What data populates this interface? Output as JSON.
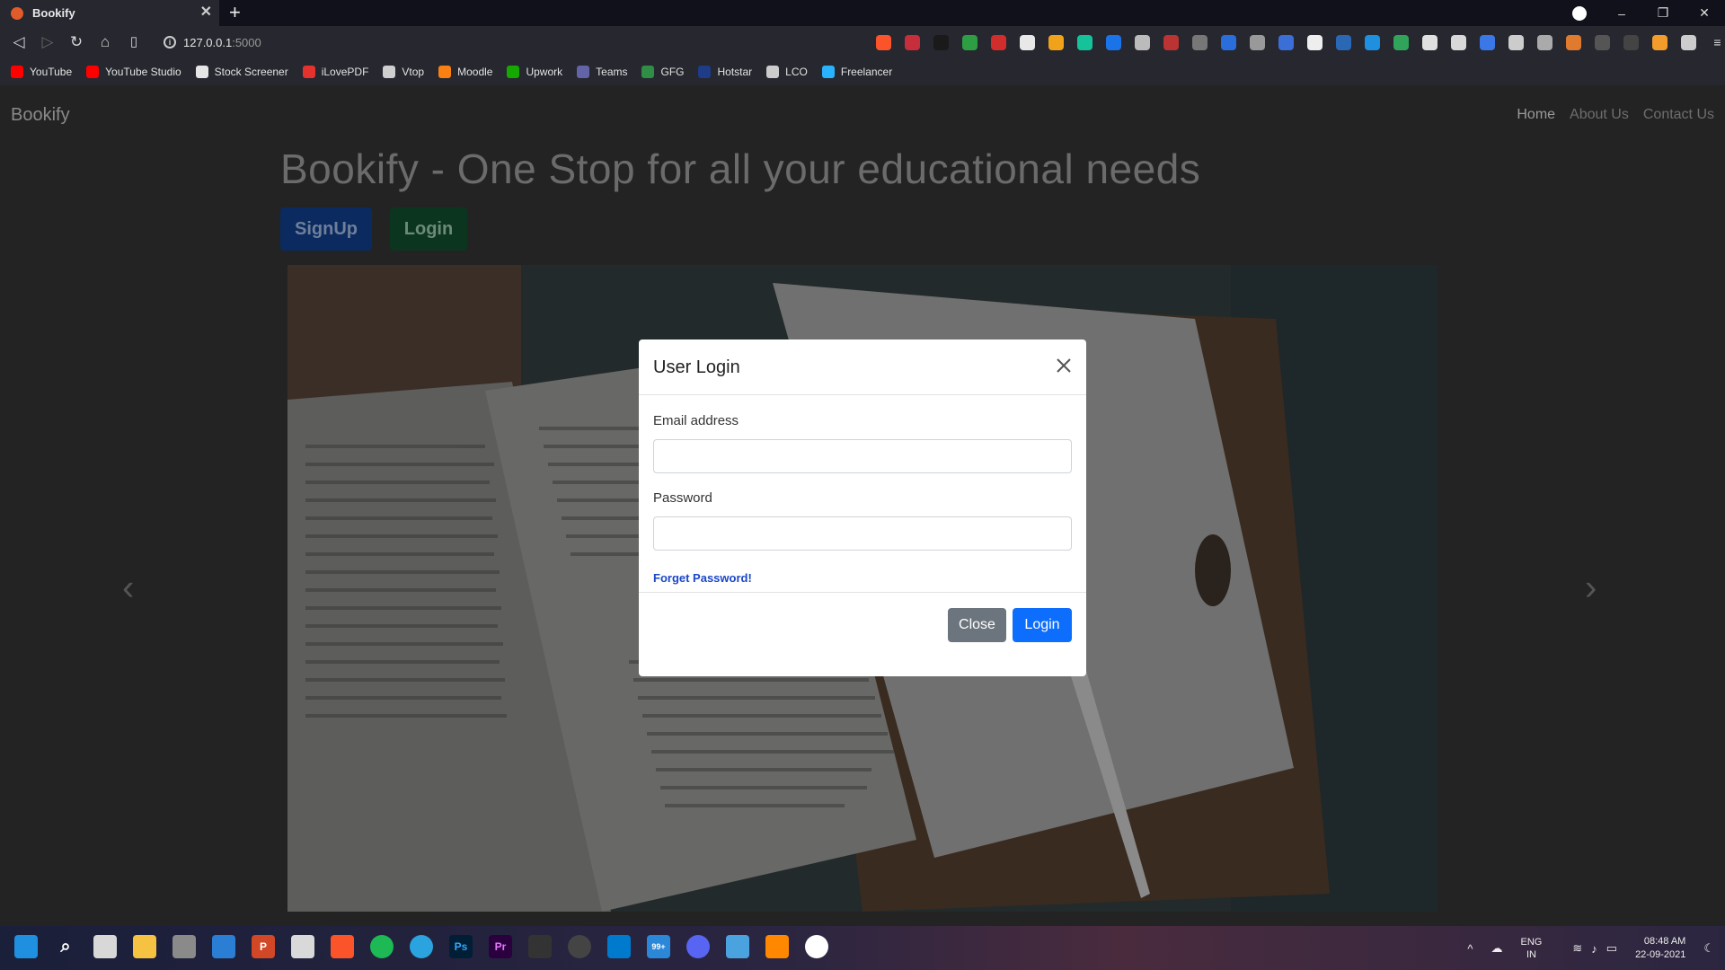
{
  "browser": {
    "tab_title": "Bookify",
    "new_tab": "+",
    "address": "127.0.0.1",
    "address_port": ":5000",
    "window_controls": [
      "–",
      "❐",
      "✕"
    ]
  },
  "bookmarks": [
    {
      "label": "YouTube",
      "icon": "youtube-icon",
      "color": "#ff0000"
    },
    {
      "label": "YouTube Studio",
      "icon": "youtube-studio-icon",
      "color": "#ff0000"
    },
    {
      "label": "Stock Screener",
      "icon": "screener-icon",
      "color": "#e6e6e6"
    },
    {
      "label": "iLovePDF",
      "icon": "ilovepdf-icon",
      "color": "#e5322d"
    },
    {
      "label": "Vtop",
      "icon": "vtop-icon",
      "color": "#cfcfcf"
    },
    {
      "label": "Moodle",
      "icon": "moodle-icon",
      "color": "#f98012"
    },
    {
      "label": "Upwork",
      "icon": "upwork-icon",
      "color": "#14a800"
    },
    {
      "label": "Teams",
      "icon": "teams-icon",
      "color": "#6264a7"
    },
    {
      "label": "GFG",
      "icon": "gfg-icon",
      "color": "#2f8d46"
    },
    {
      "label": "Hotstar",
      "icon": "hotstar-icon",
      "color": "#1f3c88"
    },
    {
      "label": "LCO",
      "icon": "lco-icon",
      "color": "#cccccc"
    },
    {
      "label": "Freelancer",
      "icon": "freelancer-icon",
      "color": "#29b2fe"
    }
  ],
  "navbar": {
    "brand": "Bookify",
    "links": [
      "Home",
      "About Us",
      "Contact Us"
    ]
  },
  "hero": {
    "title": "Bookify - One Stop for all your educational needs",
    "signup": "SignUp",
    "login": "Login"
  },
  "modal": {
    "title": "User Login",
    "email_label": "Email address",
    "password_label": "Password",
    "forgot": "Forget Password!",
    "close_button": "Close",
    "login_button": "Login"
  },
  "taskbar": {
    "lang": "ENG",
    "region": "IN",
    "time": "08:48 AM",
    "date": "22-09-2021",
    "badge": "99+"
  },
  "colors": {
    "primary": "#0d6efd",
    "secondary": "#6c757d",
    "link": "#1a47c9"
  }
}
